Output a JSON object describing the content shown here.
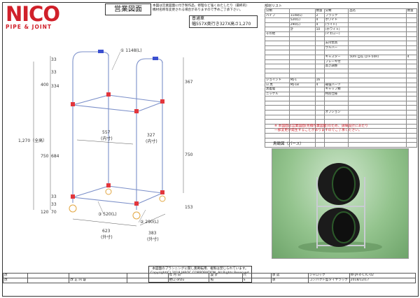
{
  "logo": {
    "main": "NICO",
    "sub": "PIPE & JOINT",
    "color": "#d0202a"
  },
  "title": "営業図面",
  "notice_top": [
    "本図は営業図面に付き製作品、修理など強くおたしたり（最終的）",
    "機材名称等変更される場合がありますので予めご了承下さい。"
  ],
  "spec": {
    "line1": "普通車",
    "line2": "幅557X奥行き327X高さ1,270"
  },
  "drawing": {
    "callouts": {
      "p1": "① 1148(L)",
      "p2": "② 290(L)",
      "p3": "③ 520(L)"
    },
    "dims": {
      "d33a": "33",
      "d33b": "33",
      "d400": "400",
      "d334": "334",
      "d367": "367",
      "d1270": "1,270（全高）",
      "d750a": "750",
      "d684": "684",
      "d750b": "750",
      "d33c": "33",
      "d33d": "33",
      "d120": "120",
      "d70": "70",
      "d153": "153",
      "d557": "557",
      "d557s": "(内寸)",
      "d327": "327",
      "d327s": "(内寸)",
      "d623": "623",
      "d623s": "(外寸)",
      "d383": "383",
      "d383s": "(外寸)"
    }
  },
  "parts": {
    "section": "部材リスト",
    "header": {
      "c1": "分類",
      "c2": "",
      "c3": "数量",
      "c4": "分類",
      "c5": "品名",
      "c6": "数量"
    },
    "rows": [
      {
        "a": "パイプ",
        "b": "1148(L)",
        "q": "2",
        "d": "ブラック",
        "e": "",
        "f": ""
      },
      {
        "a": "",
        "b": "520(L)",
        "q": "4",
        "d": "ホワイト",
        "e": "",
        "f": ""
      },
      {
        "a": "",
        "b": "290(L)",
        "q": "4",
        "d": "(ライト)",
        "e": "",
        "f": ""
      },
      {
        "a": "",
        "b": "計",
        "q": "10",
        "d": "(ホワイト)",
        "e": "",
        "f": ""
      },
      {
        "a": "その他",
        "b": "",
        "q": "",
        "d": "(イエロー)",
        "e": "",
        "f": ""
      },
      {
        "a": "",
        "b": "",
        "q": "",
        "d": "",
        "e": "",
        "f": ""
      },
      {
        "a": "",
        "b": "",
        "q": "",
        "d": "支持金具",
        "e": "",
        "f": ""
      },
      {
        "a": "",
        "b": "",
        "q": "",
        "d": "ウルパー",
        "e": "",
        "f": ""
      },
      {
        "a": "",
        "b": "",
        "q": "",
        "d": "",
        "e": "",
        "f": ""
      },
      {
        "a": "",
        "b": "",
        "q": "",
        "d": "キャスター",
        "e": "50ｍ 自在 (JTF-50R)",
        "f": "4"
      },
      {
        "a": "",
        "b": "",
        "q": "",
        "d": "ブレーキ付",
        "e": "",
        "f": ""
      },
      {
        "a": "",
        "b": "",
        "q": "",
        "d": "高さ調整",
        "e": "",
        "f": ""
      },
      {
        "a": "",
        "b": "",
        "q": "",
        "d": "",
        "e": "",
        "f": ""
      },
      {
        "a": "",
        "b": "",
        "q": "",
        "d": "",
        "e": "",
        "f": ""
      },
      {
        "a": "ジョイント",
        "b": "MJ-1",
        "q": "16",
        "d": "",
        "e": "",
        "f": ""
      },
      {
        "a": "☑ 黒",
        "b": "MJ-1B",
        "q": "4",
        "d": "補強パーツ",
        "e": "",
        "f": ""
      },
      {
        "a": "黒着電",
        "b": "",
        "q": "",
        "d": "キャップ類",
        "e": "",
        "f": ""
      },
      {
        "a": "ニッケル",
        "b": "",
        "q": "",
        "d": "特別仕様",
        "e": "",
        "f": ""
      },
      {
        "a": "",
        "b": "",
        "q": "",
        "d": "",
        "e": "",
        "f": ""
      },
      {
        "a": "",
        "b": "",
        "q": "",
        "d": "",
        "e": "",
        "f": ""
      },
      {
        "a": "",
        "b": "",
        "q": "",
        "d": "",
        "e": "",
        "f": ""
      },
      {
        "a": "",
        "b": "",
        "q": "",
        "d": "オプション",
        "e": "",
        "f": ""
      },
      {
        "a": "",
        "b": "",
        "q": "",
        "d": "",
        "e": "",
        "f": ""
      },
      {
        "a": "",
        "b": "",
        "q": "",
        "d": "",
        "e": "",
        "f": ""
      },
      {
        "a": "",
        "b": "",
        "q": "",
        "d": "",
        "e": "",
        "f": ""
      },
      {
        "a": "",
        "b": "",
        "q": "",
        "d": "",
        "e": "",
        "f": ""
      },
      {
        "a": "",
        "b": "",
        "q": "",
        "d": "",
        "e": "",
        "f": ""
      },
      {
        "a": "",
        "b": "",
        "q": "",
        "d": "",
        "e": "",
        "f": ""
      },
      {
        "a": "",
        "b": "",
        "q": "",
        "d": "",
        "e": "",
        "f": ""
      }
    ]
  },
  "note_red": [
    "※ 本図面は営業図面(見積作業図面)のため、詳細設計にあたり",
    "一部変更が発生することがありますのでご了承ください。"
  ],
  "perspective_label": "鳥瞰図（パース）",
  "notice_bottom": [
    "本図面のプランニングに関し無断転用、複製は禁じられています。",
    "Copyright(C) 2018 JAROC CORPORATION. All Rights Reserved."
  ],
  "title_block": {
    "headers": {
      "a": "",
      "b": "改",
      "c": "改 正 内 容",
      "d": "年 月 日",
      "e": "",
      "f": "設 計",
      "g": "照",
      "h": "尺",
      "i": "承 認",
      "j": "図番",
      "k": "",
      "l": ""
    },
    "revision_rows": [
      {
        "rev": "",
        "content": "",
        "date": ""
      },
      {
        "rev": "",
        "content": "",
        "date": ""
      }
    ],
    "scale": "S",
    "drawn_by": "野口 ohzu",
    "approved_by": "承",
    "drawing_no": "W-JA-4-CTC-02",
    "date": "2018/12/17",
    "company": "ジャロック",
    "product": "コンパクト型タイヤラック"
  }
}
